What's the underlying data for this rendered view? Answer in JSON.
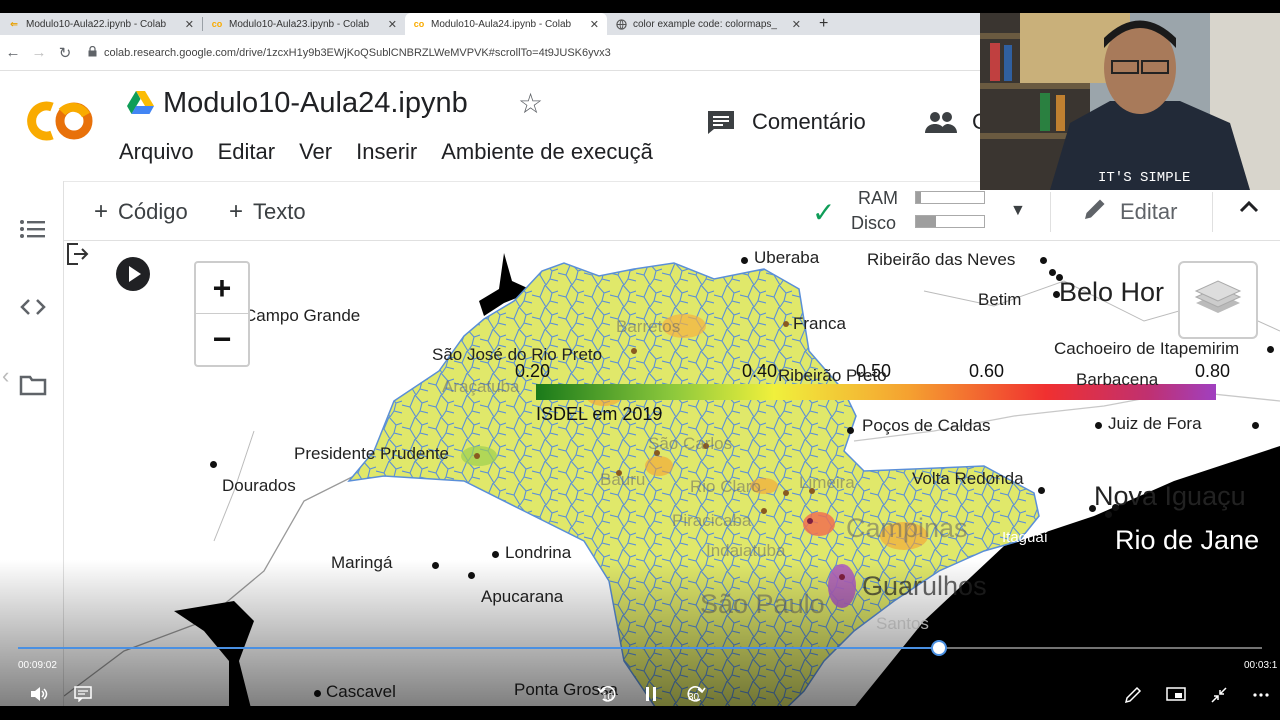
{
  "browser": {
    "tabs": [
      {
        "title": "Modulo10-Aula22.ipynb - Colab",
        "icon": "back-arrow-icon",
        "active": false
      },
      {
        "title": "Modulo10-Aula23.ipynb - Colab",
        "icon": "colab-icon",
        "active": false
      },
      {
        "title": "Modulo10-Aula24.ipynb - Colab",
        "icon": "colab-icon",
        "active": true
      },
      {
        "title": "color example code: colormaps_",
        "icon": "globe-icon",
        "active": false
      }
    ],
    "close_glyph": "✕",
    "new_tab_glyph": "+",
    "url": "colab.research.google.com/drive/1zcxH1y9b3EWjKoQSublCNBRZLWeMVPVK#scrollTo=4t9JUSK6yvx3"
  },
  "header": {
    "notebook_title": "Modulo10-Aula24.ipynb",
    "menu": [
      "Arquivo",
      "Editar",
      "Ver",
      "Inserir",
      "Ambiente de execuçã"
    ],
    "comment_label": "Comentário",
    "share_label": "C",
    "logo_colors": {
      "left": "#f9ab00",
      "right": "#e8710a"
    }
  },
  "toolbar": {
    "code_label": "Código",
    "text_label": "Texto",
    "ram_label": "RAM",
    "disk_label": "Disco",
    "ram_usage": 0.08,
    "disk_usage": 0.3,
    "edit_label": "Editar",
    "accent": "#0f9d58"
  },
  "map": {
    "zoom_in": "+",
    "zoom_out": "−",
    "legend": {
      "ticks": [
        "0.20",
        "0.40",
        "0.50",
        "0.60",
        "0.80"
      ],
      "caption": "ISDEL em 2019",
      "colors": [
        "#1a7a1a",
        "#8cc83c",
        "#f0f03c",
        "#f5a030",
        "#f03030",
        "#c03070",
        "#a040c0"
      ]
    },
    "cities": [
      {
        "name": "Uberaba"
      },
      {
        "name": "Ribeirão das Neves"
      },
      {
        "name": "Betim"
      },
      {
        "name": "Belo Hor"
      },
      {
        "name": "Campo Grande"
      },
      {
        "name": "Barretos"
      },
      {
        "name": "Franca"
      },
      {
        "name": "São José do Rio Preto"
      },
      {
        "name": "Ribeirão Preto"
      },
      {
        "name": "Cachoeiro de Itapemirim"
      },
      {
        "name": "Barbacena"
      },
      {
        "name": "Araçatuba"
      },
      {
        "name": "Poços de Caldas"
      },
      {
        "name": "Juiz de Fora"
      },
      {
        "name": "São Carlos"
      },
      {
        "name": "Presidente Prudente"
      },
      {
        "name": "Dourados"
      },
      {
        "name": "Bauru"
      },
      {
        "name": "Rio Claro"
      },
      {
        "name": "Limeira"
      },
      {
        "name": "Volta Redonda"
      },
      {
        "name": "Nova Iguaçu"
      },
      {
        "name": "Piracicaba"
      },
      {
        "name": "Campinas"
      },
      {
        "name": "Rio de Jane"
      },
      {
        "name": "Itaguaí"
      },
      {
        "name": "Maringá"
      },
      {
        "name": "Londrina"
      },
      {
        "name": "Indaiatuba"
      },
      {
        "name": "Apucarana"
      },
      {
        "name": "Guarulhos"
      },
      {
        "name": "São Paulo"
      },
      {
        "name": "Santos"
      },
      {
        "name": "Cascavel"
      },
      {
        "name": "Ponta Grossa"
      }
    ]
  },
  "video": {
    "elapsed": "00:09:02",
    "remaining": "00:03:1",
    "progress": 0.74,
    "skip_back": "10",
    "skip_forward": "30"
  }
}
